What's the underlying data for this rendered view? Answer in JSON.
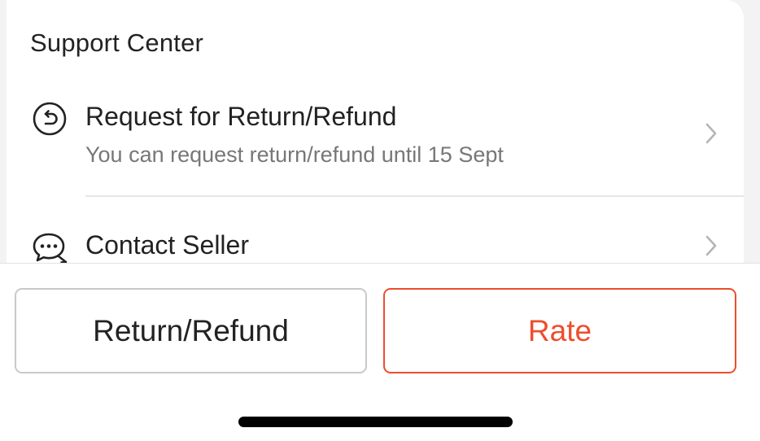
{
  "support_center": {
    "title": "Support Center",
    "items": [
      {
        "icon": "return-icon",
        "label": "Request for Return/Refund",
        "subtitle": "You can request return/refund until 15 Sept",
        "chevron_icon": "chevron-right-icon"
      },
      {
        "icon": "chat-bubbles-icon",
        "label": "Contact Seller",
        "chevron_icon": "chevron-right-icon"
      }
    ]
  },
  "actions": {
    "return_refund_label": "Return/Refund",
    "rate_label": "Rate"
  },
  "colors": {
    "accent": "#ee4d2d",
    "text_primary": "#222222",
    "text_secondary": "#777777",
    "button_border": "#c9c9c9",
    "background": "#f3f3f3"
  }
}
